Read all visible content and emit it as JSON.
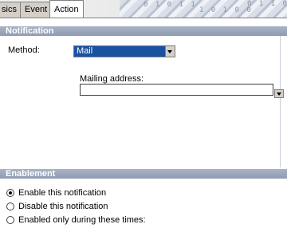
{
  "tabs": [
    {
      "label": "sics",
      "active": false
    },
    {
      "label": "Event",
      "active": false
    },
    {
      "label": "Action",
      "active": true
    }
  ],
  "header_deco_text": [
    "0 1 0 1 1",
    "1 0 1 0 0",
    "0 1 1 0 1"
  ],
  "notification": {
    "header": "Notification",
    "method_label": "Method:",
    "method_value": "Mail",
    "mailing_label": "Mailing address:",
    "mailing_value": ""
  },
  "enablement": {
    "header": "Enablement",
    "options": [
      {
        "label": "Enable this notification",
        "selected": true
      },
      {
        "label": "Disable this notification",
        "selected": false
      },
      {
        "label": "Enabled only during these times:",
        "selected": false
      }
    ]
  },
  "colors": {
    "section_header": "#9aa5bb",
    "select_highlight": "#1a52a0"
  },
  "icons": [
    "chevron-down-icon",
    "radio-icon"
  ]
}
